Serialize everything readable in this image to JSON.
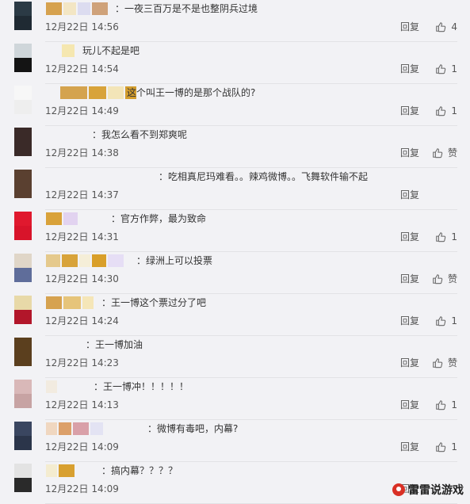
{
  "colors": {
    "background": "#f2f2f5",
    "text": "#333333",
    "meta": "#555555"
  },
  "icons": {
    "like": "thumbs-up-icon"
  },
  "reply_label": "回复",
  "comments": [
    {
      "text": "：一夜三百万是不是也整阴兵过境",
      "time": "12月22日 14:56",
      "likes": "4",
      "avatar": [
        "#2b3a45",
        "#1f2a33"
      ],
      "name_blocks": [
        "#d6a24f",
        "#f3e6c4",
        "#dcdcf0",
        "#cfa27a"
      ]
    },
    {
      "text": "玩儿不起是吧",
      "time": "12月22日 14:54",
      "likes": "1",
      "avatar": [
        "#cfd6da",
        "#141414"
      ],
      "name_blocks": [
        "#f5e7b0"
      ]
    },
    {
      "text": "这个叫王一博的是那个战队的?",
      "time": "12月22日 14:49",
      "likes": "1",
      "avatar": [
        "#f7f7f7",
        "#eeeeee"
      ],
      "name_blocks": [
        "#d4a34e",
        "#d8a33a",
        "#f3e5b8",
        "#d39d2d"
      ]
    },
    {
      "text": "：我怎么看不到郑爽呢",
      "time": "12月22日 14:38",
      "likes": "赞",
      "avatar": [
        "#3a2a28",
        "#3a2a28"
      ],
      "name_blocks": []
    },
    {
      "text": "：吃相真尼玛难看。。辣鸡微博。。飞舞软件输不起",
      "time": "12月22日 14:37",
      "likes": "",
      "avatar": [
        "#5a4030",
        "#5a4030"
      ],
      "name_blocks": []
    },
    {
      "text": "：官方作弊，最为致命",
      "time": "12月22日 14:31",
      "likes": "1",
      "avatar": [
        "#e0192e",
        "#d8142a"
      ],
      "name_blocks": [
        "#d9a23a",
        "#e2d3f0"
      ]
    },
    {
      "text": "：绿洲上可以投票",
      "time": "12月22日 14:30",
      "likes": "赞",
      "avatar": [
        "#e0d6c8",
        "#5f6d9a"
      ],
      "name_blocks": [
        "#e5c98c",
        "#d8a33a",
        "#f5eed8",
        "#d99f2a",
        "#e6def5"
      ]
    },
    {
      "text": "：王一博这个票过分了吧",
      "time": "12月22日 14:24",
      "likes": "1",
      "avatar": [
        "#e8d9a8",
        "#b2162a"
      ],
      "name_blocks": [
        "#d6a24f",
        "#e6c47a",
        "#f5e6b8"
      ]
    },
    {
      "text": "：王一博加油",
      "time": "12月22日 14:23",
      "likes": "赞",
      "avatar": [
        "#5b3f1e",
        "#5b3f1e"
      ],
      "name_blocks": []
    },
    {
      "text": "：王一博冲！！！！！",
      "time": "12月22日 14:13",
      "likes": "1",
      "avatar": [
        "#d9b8b8",
        "#c7a3a3"
      ],
      "name_blocks": [
        "#f2ebe0"
      ]
    },
    {
      "text": "：微博有毒吧，内幕?",
      "time": "12月22日 14:09",
      "likes": "1",
      "avatar": [
        "#3a4660",
        "#2b354a"
      ],
      "name_blocks": [
        "#f0d7c0",
        "#dca06a",
        "#d9a0a8",
        "#e3e3f3"
      ]
    },
    {
      "text": "：搞内幕？？？？",
      "time": "12月22日 14:09",
      "likes": "",
      "avatar": [
        "#e3e3e3",
        "#2a2a2a"
      ],
      "name_blocks": [
        "#f4ecd0",
        "#d8a030"
      ]
    }
  ],
  "watermark": "雷雷说游戏"
}
